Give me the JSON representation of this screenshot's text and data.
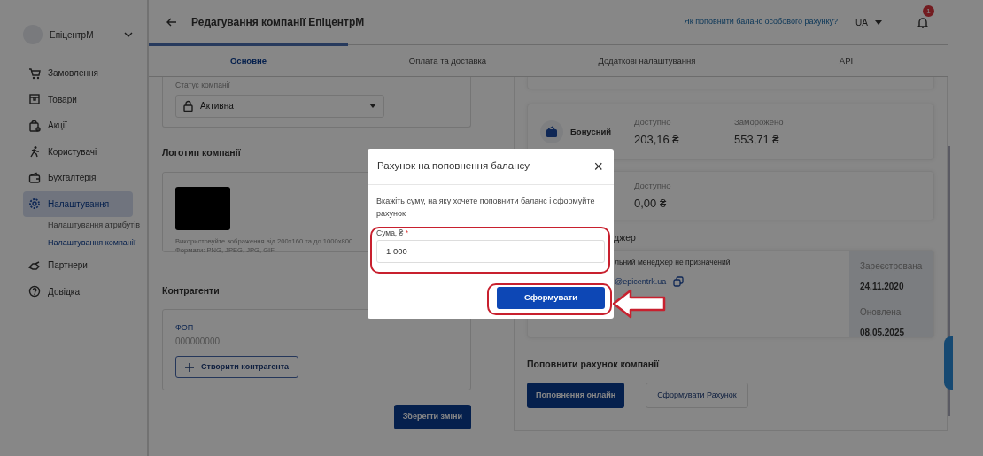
{
  "sidebar": {
    "company": "ЕпіцентрМ",
    "items": [
      {
        "label": "Замовлення",
        "selected": false
      },
      {
        "label": "Товари",
        "selected": false
      },
      {
        "label": "Акції",
        "selected": false
      },
      {
        "label": "Користувачі",
        "selected": false
      },
      {
        "label": "Бухгалтерія",
        "selected": false
      },
      {
        "label": "Налаштування",
        "selected": true,
        "children": [
          {
            "label": "Налаштування атрибутів",
            "selected": false
          },
          {
            "label": "Налаштування компанії",
            "selected": true
          }
        ]
      },
      {
        "label": "Партнери",
        "selected": false
      },
      {
        "label": "Довідка",
        "selected": false
      }
    ]
  },
  "header": {
    "title": "Редагування компанії ЕпіцентрМ",
    "help_link": "Як поповнити баланс особового рахунку?",
    "language": "UA",
    "notifications": "1"
  },
  "tabs": [
    {
      "label": "Основне",
      "selected": true
    },
    {
      "label": "Оплата та доставка",
      "selected": false
    },
    {
      "label": "Додаткові налаштування",
      "selected": false
    },
    {
      "label": "API",
      "selected": false
    }
  ],
  "company_status": {
    "label": "Статус компанії",
    "value": "Активна"
  },
  "logo": {
    "heading": "Логотип компанії",
    "hint": "Використовуйте зображення від 200x160 та до 1000x800",
    "formats": "Формати: PNG, JPEG, JPG, GIF"
  },
  "counterparties": {
    "heading": "Контрагенти",
    "items": [
      {
        "type": "ФОП",
        "code": "000000000"
      }
    ],
    "create_button": "Створити контрагента"
  },
  "save_button": "Зберегти зміни",
  "balances": [
    {
      "name": "Бонусний",
      "fields": [
        {
          "label": "Доступно",
          "value": "203,16 ₴"
        },
        {
          "label": "Заморожено",
          "value": "553,71 ₴"
        }
      ]
    },
    {
      "fields": [
        {
          "label": "Доступно",
          "value": "0,00 ₴"
        }
      ]
    }
  ],
  "manager": {
    "heading": "джер",
    "note": "льний менеджер не призначений",
    "email": "@epicentrk.ua",
    "registered_label": "Зареєстрована",
    "registered": "24.11.2020",
    "updated_label": "Оновлена",
    "updated": "08.05.2025"
  },
  "top_up": {
    "heading": "Поповнити рахунок компанії",
    "buttons": [
      "Поповнення онлайн",
      "Сформувати Рахунок"
    ]
  },
  "modal": {
    "title": "Рахунок на поповнення балансу",
    "close": "×",
    "text": "Вкажіть суму, на яку хочете поповнити баланс і сформуйте рахунок",
    "field_label": "Сума, ₴",
    "required_mark": "*",
    "value": "1 000",
    "submit": "Сформувати"
  }
}
